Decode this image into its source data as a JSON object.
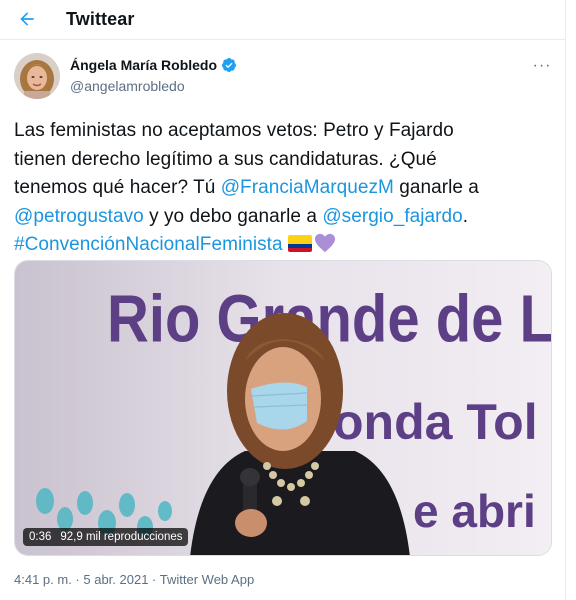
{
  "header": {
    "title": "Twittear",
    "back_icon": "arrow-left-icon"
  },
  "author": {
    "name": "Ángela María Robledo",
    "handle": "@angelamrobledo",
    "verified": true,
    "verified_icon": "verified-badge-icon"
  },
  "more_icon": "more-options-icon",
  "more_label": "···",
  "tweet": {
    "line1": "Las feministas no aceptamos vetos: Petro y Fajardo",
    "line2": "tienen derecho legítimo a sus candidaturas. ¿Qué",
    "line3_pre": "tenemos qué hacer? Tú ",
    "mention_francia": "@FranciaMarquezM",
    "line3_post": " ganarle a",
    "mention_petro": "@petrogustavo",
    "line4_mid": " y yo debo ganarle a ",
    "mention_sergio": "@sergio_fajardo",
    "line4_end": ".",
    "hashtag": "#ConvenciónNacionalFeminista",
    "emojis": [
      "colombia-flag-emoji",
      "purple-heart-emoji"
    ]
  },
  "media": {
    "type": "video",
    "banner_line1": "Rio Grande de La",
    "banner_line2": "onda Tol",
    "banner_line3": "e abri",
    "duration": "0:36",
    "views": "92,9 mil reproducciones"
  },
  "meta": {
    "time": "4:41 p. m.",
    "separator1": " · ",
    "date": "5 abr. 2021",
    "separator2": " · ",
    "source": "Twitter Web App"
  },
  "colors": {
    "accent": "#1da1f2",
    "link": "#1b95e0",
    "text": "#0f1419",
    "secondary": "#5b7083",
    "border": "#e6ecf0"
  }
}
